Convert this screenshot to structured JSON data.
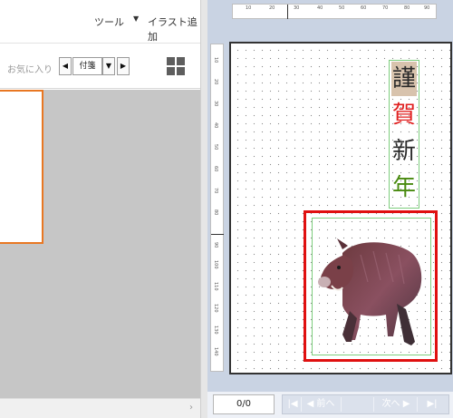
{
  "toolbar": {
    "tool_label": "ツール",
    "dropdown_arrow": "▼",
    "add_illust_label": "イラスト追加"
  },
  "favorites": {
    "label": "お気に入り",
    "prev": "◀",
    "selected": "付箋",
    "dropdown": "▼",
    "next": "▶"
  },
  "hscroll": {
    "arrow": "›"
  },
  "ruler": {
    "top_ticks": [
      "10",
      "20",
      "30",
      "40",
      "50",
      "60",
      "70",
      "80",
      "90"
    ],
    "left_ticks": [
      "10",
      "20",
      "30",
      "40",
      "50",
      "60",
      "70",
      "80",
      "90",
      "100",
      "110",
      "120",
      "130",
      "140"
    ]
  },
  "card": {
    "text_chars": [
      "謹",
      "賀",
      "新",
      "年"
    ],
    "colors": {
      "k1": "#2a2a2a",
      "k2": "#e02020",
      "k3": "#2a2a2a",
      "k4": "#4a8a10",
      "selection": "#e01010",
      "frame": "#7dce7d"
    }
  },
  "bottom_nav": {
    "page_counter": "0/0",
    "first": "|◀",
    "prev": "◀ 前へ",
    "next": "次へ ▶",
    "last": "▶|"
  },
  "icons": [
    "grid-view-icon",
    "boar-illustration"
  ]
}
